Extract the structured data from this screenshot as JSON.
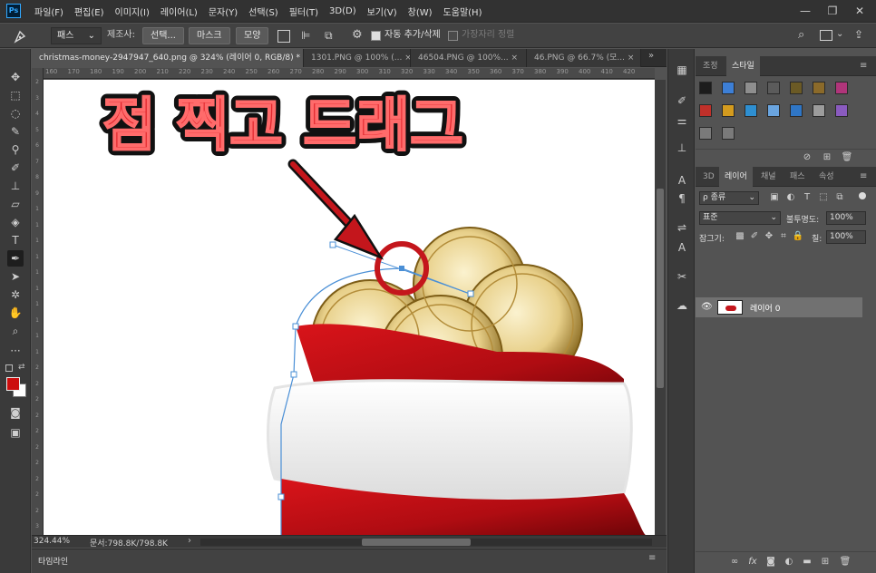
{
  "app": {
    "logo": "Ps"
  },
  "menu": [
    "파일(F)",
    "편집(E)",
    "이미지(I)",
    "레이어(L)",
    "문자(Y)",
    "선택(S)",
    "필터(T)",
    "3D(D)",
    "보기(V)",
    "창(W)",
    "도움말(H)"
  ],
  "window_controls": {
    "minimize": "—",
    "restore": "❐",
    "close": "✕"
  },
  "options": {
    "tool_icon": "pen-icon",
    "mode_select": "패스",
    "make_label": "제조사:",
    "selection_btn": "선택...",
    "mask_btn": "마스크",
    "shape_btn": "모양",
    "auto_add_delete": "자동 추가/삭제",
    "align_edges": "가장자리 정렬"
  },
  "tabs": [
    {
      "label": "christmas-money-2947947_640.png @ 324% (레이어 0, RGB/8) *",
      "close": "×"
    },
    {
      "label": "1301.PNG @ 100% (...",
      "close": "×"
    },
    {
      "label": "46504.PNG @ 100%...",
      "close": "×"
    },
    {
      "label": "46.PNG @ 66.7% (모...",
      "close": "×"
    }
  ],
  "ruler_h": [
    "160",
    "170",
    "180",
    "190",
    "200",
    "210",
    "220",
    "230",
    "240",
    "250",
    "260",
    "270",
    "280",
    "290",
    "300",
    "310",
    "320",
    "330",
    "340",
    "350",
    "360",
    "370",
    "380",
    "390",
    "400",
    "410",
    "420"
  ],
  "ruler_v": [
    "2",
    "3",
    "4",
    "5",
    "6",
    "7",
    "8",
    "9",
    "1",
    "1",
    "1",
    "1",
    "1",
    "1",
    "1",
    "1",
    "1",
    "1",
    "2",
    "2",
    "2",
    "2",
    "2",
    "2",
    "2",
    "2",
    "2",
    "2",
    "3"
  ],
  "canvas": {
    "headline": "점 찍고 드래그"
  },
  "status": {
    "zoom": "324.44%",
    "doc": "문서:798.8K/798.8K",
    "arrow": "›"
  },
  "timeline": {
    "label": "타임라인"
  },
  "panels": {
    "top_tabs": [
      "조정",
      "스타일"
    ],
    "bottom_tabs": [
      "3D",
      "레이어",
      "채널",
      "패스",
      "속성"
    ],
    "menu_glyph": "≡",
    "filter_kind": "ρ 종류",
    "blend_mode": "표준",
    "opacity_label": "불투명도:",
    "opacity_value": "100%",
    "lock_label": "잠그기:",
    "fill_label": "칠:",
    "fill_value": "100%",
    "layer_name": "레이어 0",
    "styles_swatches": [
      "#1c1c1c",
      "#3d7fd6",
      "#8e8e8e",
      "#5b5b5b",
      "#6b5a25",
      "#8b6a2a",
      "#b0357a",
      "#c0302a",
      "#d49b1e",
      "#2e8fd1",
      "#6aa5e0",
      "#2f76c6",
      "#9c9c9c",
      "#8a5bbf",
      "#7a7a7a",
      "#7a7a7a"
    ]
  }
}
